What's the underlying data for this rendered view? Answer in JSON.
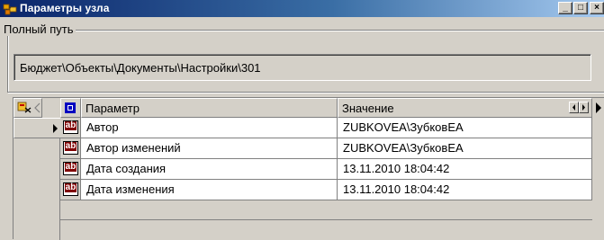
{
  "window": {
    "title": "Параметры узла",
    "buttons": {
      "minimize": "_",
      "maximize": "□",
      "close": "×"
    }
  },
  "path_group": {
    "label": "Полный путь",
    "value": "Бюджет\\Объекты\\Документы\\Настройки\\301"
  },
  "grid": {
    "columns": {
      "param": "Параметр",
      "value": "Значение"
    },
    "current_row": 0,
    "rows": [
      {
        "param": "Автор",
        "value": "ZUBKOVEA\\ЗубковЕА",
        "icon": "text-field-icon"
      },
      {
        "param": "Автор изменений",
        "value": "ZUBKOVEA\\ЗубковЕА",
        "icon": "text-field-icon"
      },
      {
        "param": "Дата создания",
        "value": "13.11.2010 18:04:42",
        "icon": "text-field-icon"
      },
      {
        "param": "Дата изменения",
        "value": "13.11.2010 18:04:42",
        "icon": "text-field-icon"
      }
    ],
    "icons": {
      "column_chooser": "column-chooser-icon",
      "header_type": "checkbox-column-icon",
      "current_row_marker": "row-pointer-icon"
    },
    "colors": {
      "header_check": "#0000c0",
      "ab_icon_bg": "#800000"
    }
  }
}
